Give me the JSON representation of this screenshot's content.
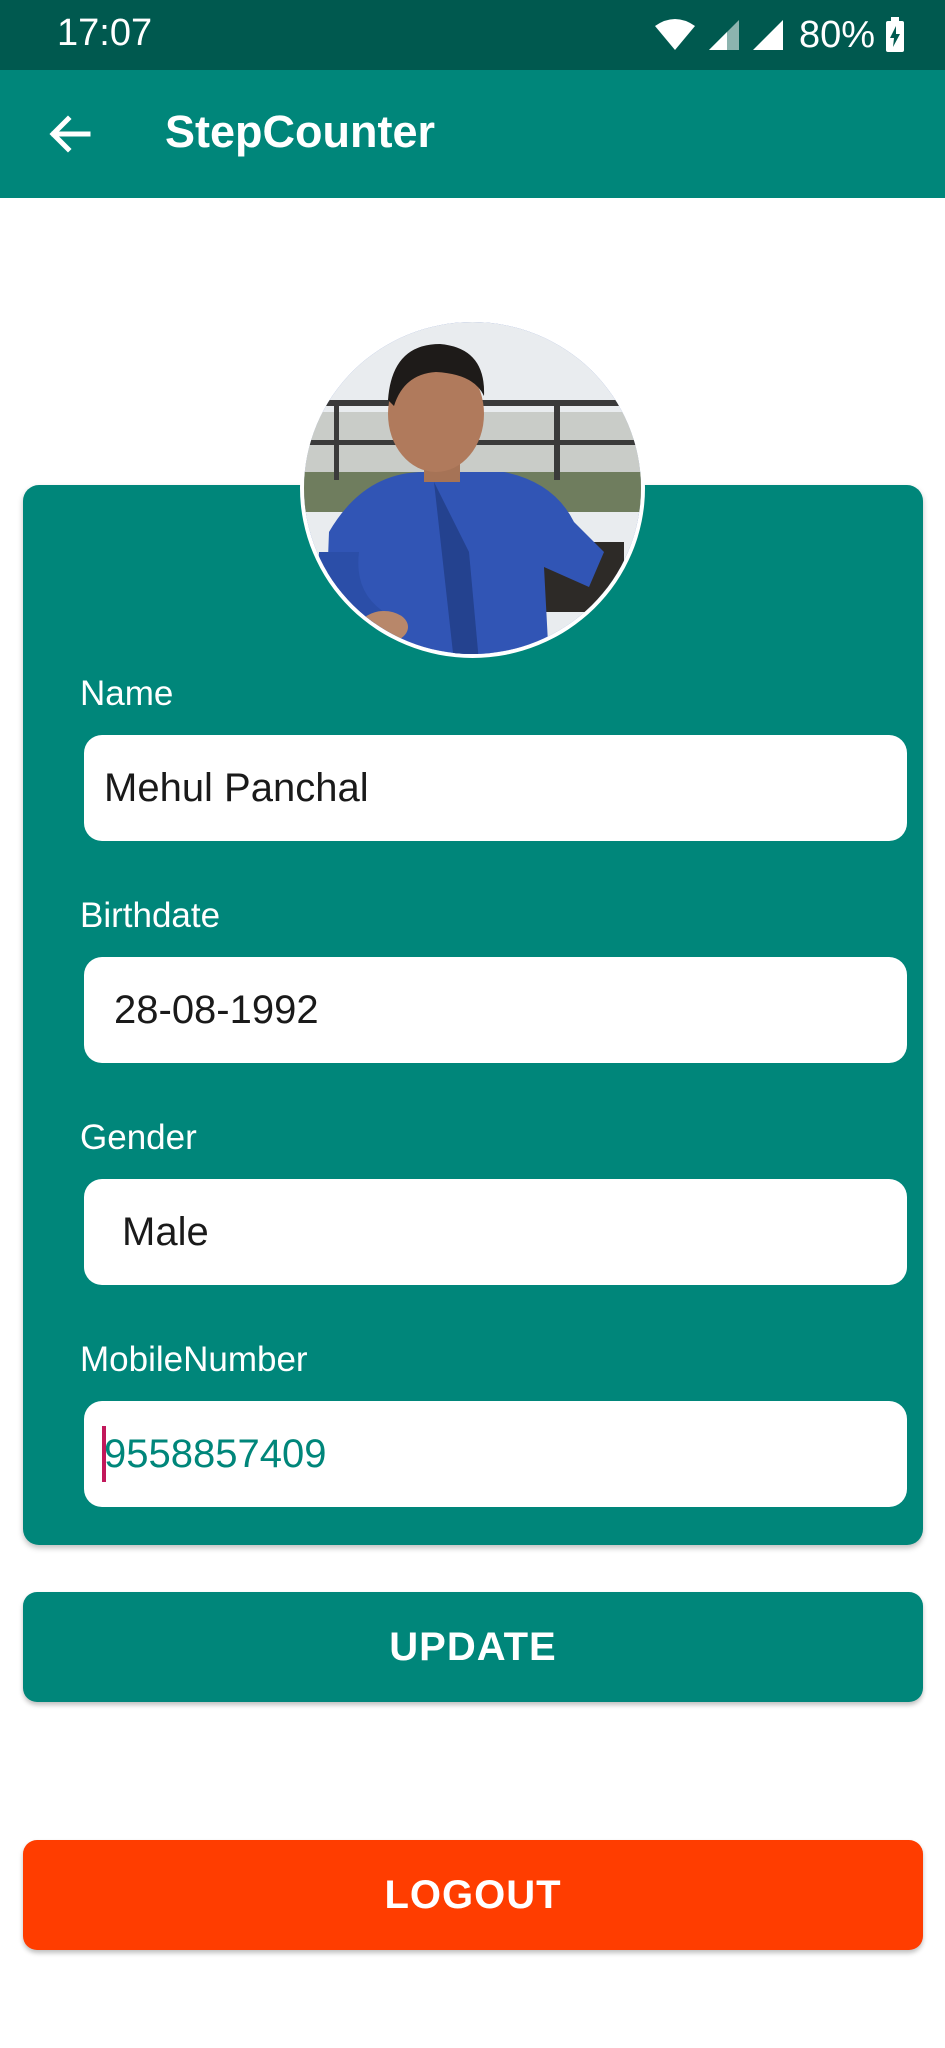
{
  "status_bar": {
    "time": "17:07",
    "battery": "80%",
    "icons": [
      "wifi-icon",
      "signal-icon",
      "signal-icon",
      "battery-charging-icon"
    ]
  },
  "app_bar": {
    "back_icon": "arrow-left-icon",
    "title": "StepCounter"
  },
  "profile": {
    "avatar": "profile-photo",
    "fields": {
      "name": {
        "label": "Name",
        "value": "Mehul Panchal"
      },
      "birthdate": {
        "label": "Birthdate",
        "value": "28-08-1992"
      },
      "gender": {
        "label": "Gender",
        "value": "Male"
      },
      "mobile": {
        "label": "MobileNumber",
        "value": "9558857409"
      }
    }
  },
  "actions": {
    "update_label": "UPDATE",
    "logout_label": "LOGOUT"
  },
  "colors": {
    "status_bar": "#00594f",
    "primary": "#00867a",
    "logout": "#ff3d00",
    "cursor": "#c2185b"
  }
}
